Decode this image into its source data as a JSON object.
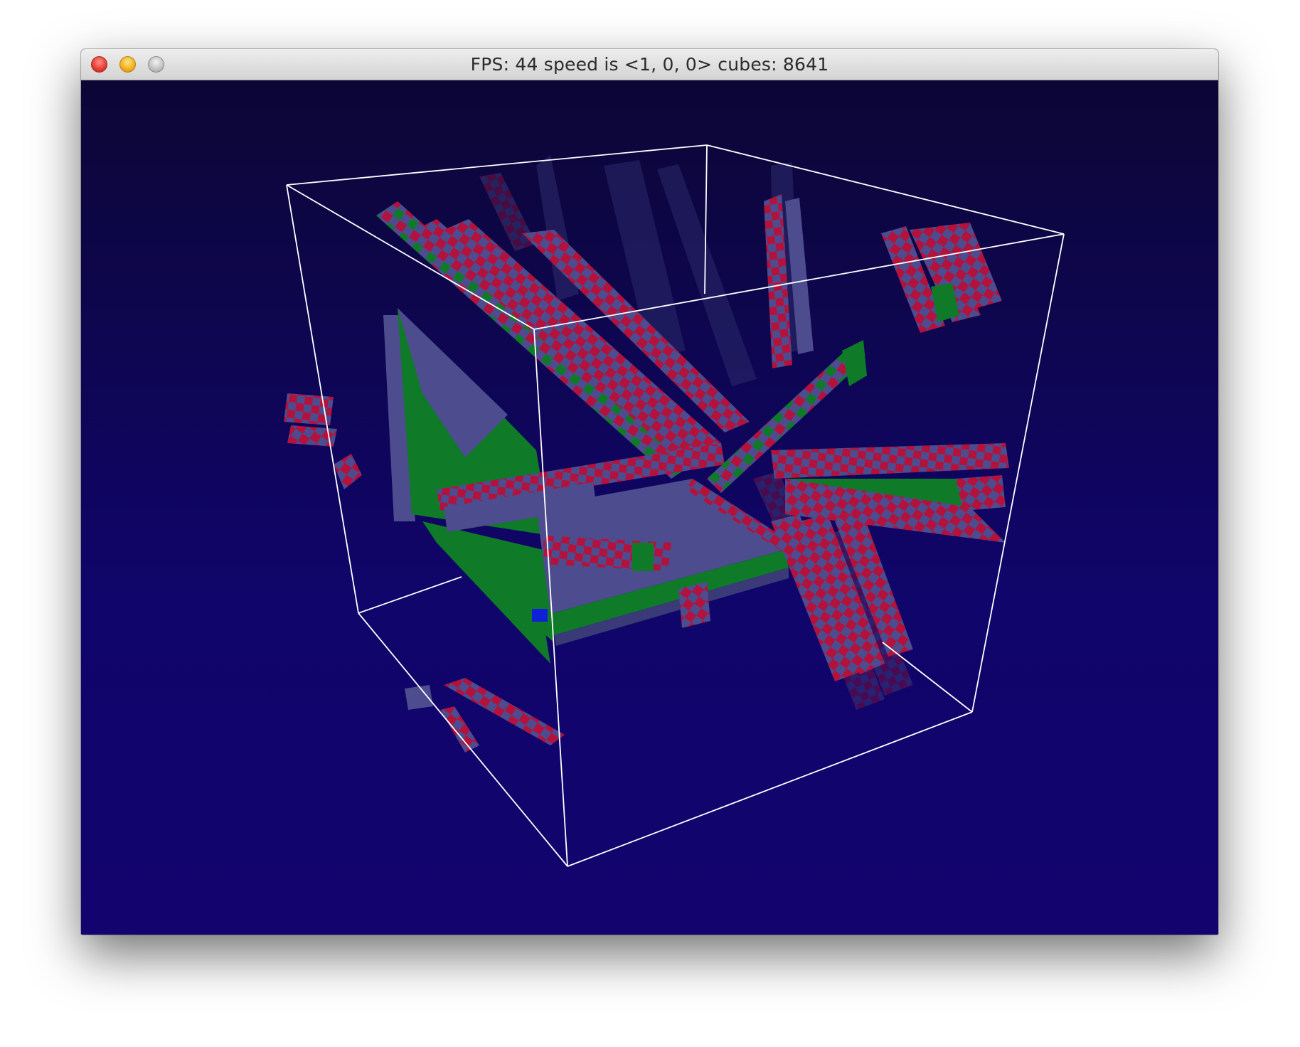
{
  "window": {
    "title": "FPS: 44 speed is <1, 0, 0> cubes: 8641",
    "buttons": [
      "close",
      "minimize",
      "zoom"
    ]
  },
  "scene": {
    "background_top": "#0c0636",
    "background_bottom": "#12036e",
    "bounding_box_color": "#ffffff",
    "voxel_colors": {
      "slate": "#4d4c8e",
      "red": "#b3123c",
      "green": "#0f7a28",
      "blue": "#1020d8"
    }
  }
}
